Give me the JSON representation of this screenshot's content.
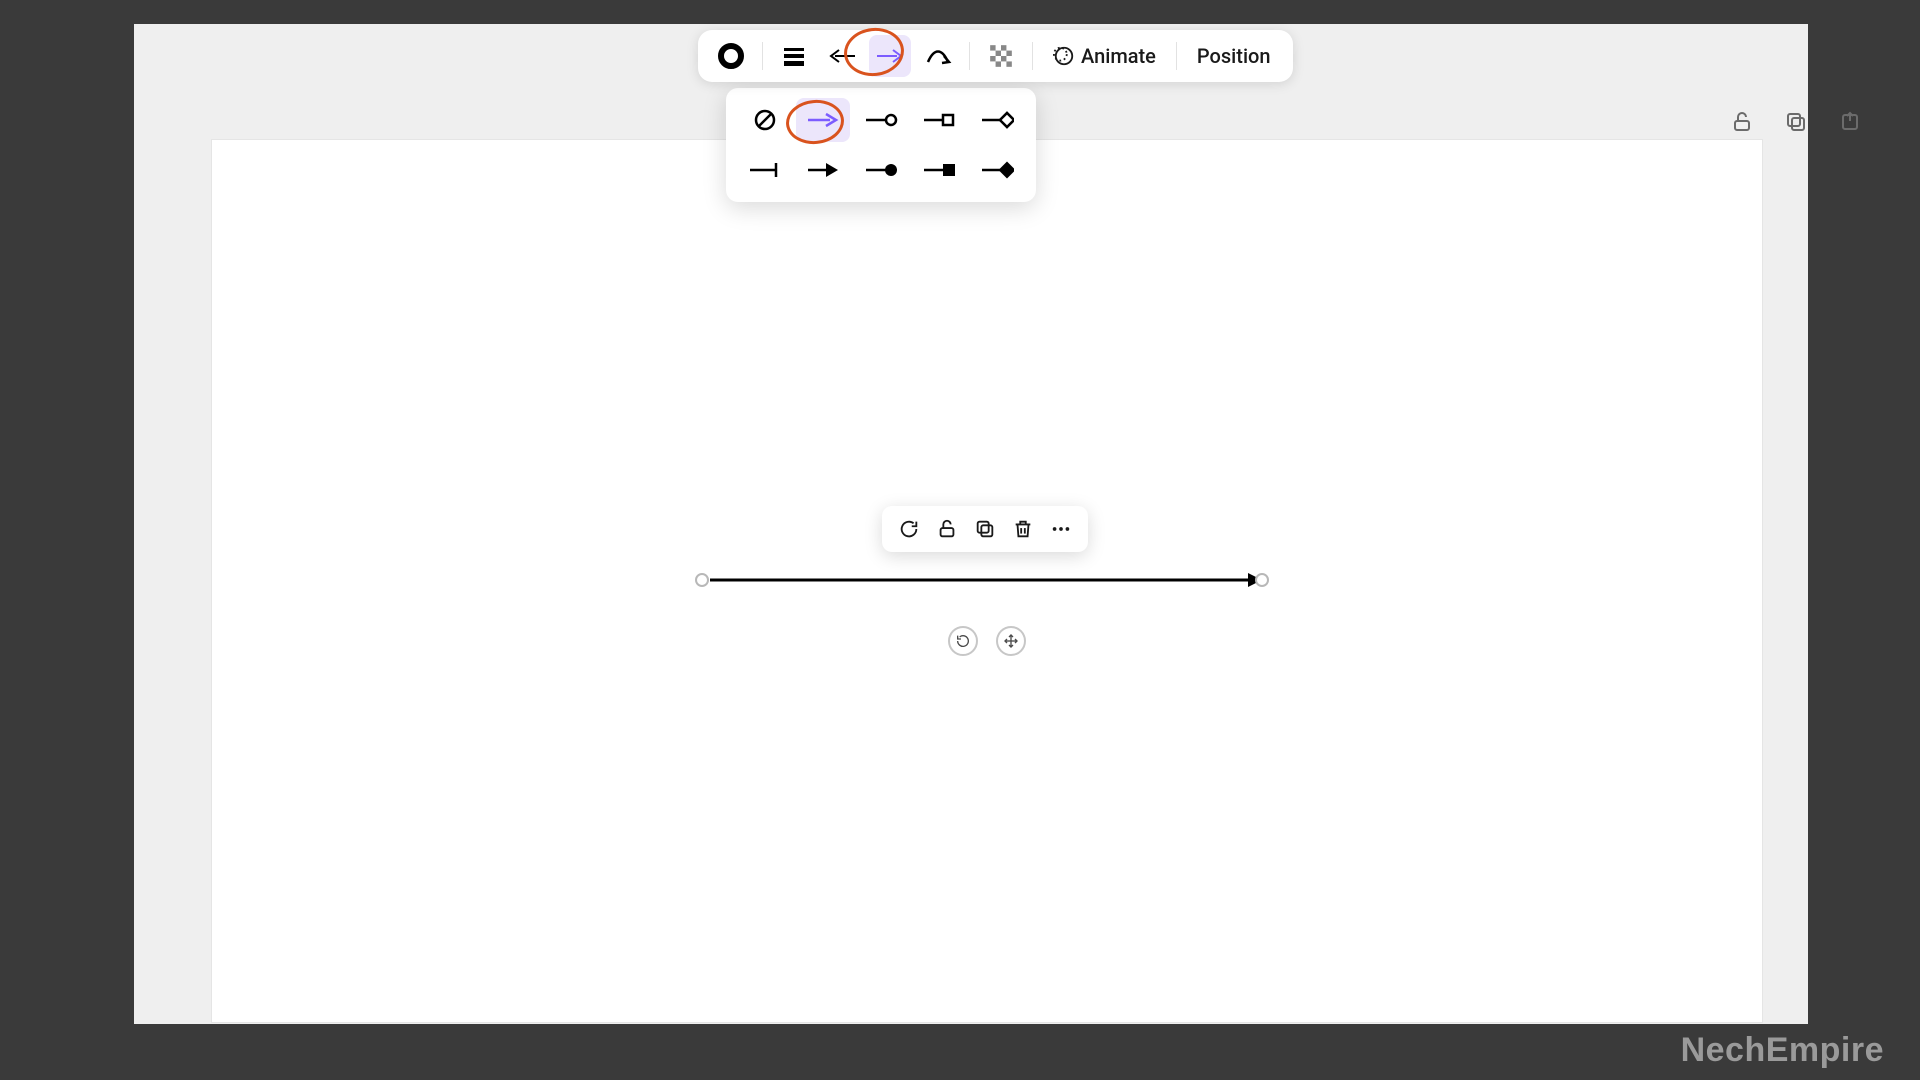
{
  "toolbar": {
    "animate_label": "Animate",
    "position_label": "Position",
    "icons": {
      "color": "line-color-icon",
      "weight": "line-weight-icon",
      "start": "line-start-icon",
      "end": "line-end-icon",
      "style": "line-style-icon",
      "transparency": "transparency-icon",
      "animate": "animate-icon"
    },
    "active_tool": "line-end"
  },
  "arrow_end_options": {
    "row1": [
      "none",
      "arrow-open",
      "circle-open",
      "square-open",
      "diamond-open"
    ],
    "row2": [
      "bar",
      "arrow-solid",
      "circle-solid",
      "square-solid",
      "diamond-solid"
    ],
    "selected": "arrow-open"
  },
  "corner_actions": {
    "lock": "unlock-icon",
    "copy": "copy-icon",
    "share": "share-icon"
  },
  "context_toolbar": {
    "sync": "sync-icon",
    "lock": "lock-icon",
    "duplicate": "duplicate-icon",
    "delete": "trash-icon",
    "more": "more-icon"
  },
  "shape": {
    "type": "line-arrow",
    "end_style": "arrow-open"
  },
  "below_handles": {
    "rotate": "rotate-icon",
    "move": "move-icon"
  },
  "watermark": "NechEmpire",
  "colors": {
    "accent_purple": "#7c5cff",
    "accent_bg": "#ece6fb",
    "annotation": "#d9531e"
  }
}
